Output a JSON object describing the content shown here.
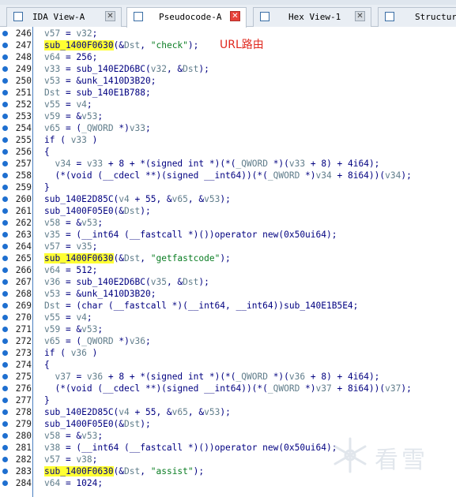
{
  "tabs": [
    {
      "label": "IDA View-A",
      "active": false,
      "icon": "ida-view-icon"
    },
    {
      "label": "Pseudocode-A",
      "active": true,
      "icon": "pseudocode-icon"
    },
    {
      "label": "Hex View-1",
      "active": false,
      "icon": "hex-view-icon"
    },
    {
      "label": "Structure",
      "active": false,
      "icon": "structure-icon"
    }
  ],
  "annotation": "URL路由",
  "watermark": "看雪",
  "colors": {
    "highlight": "#ffff33",
    "string": "#0a7d23",
    "variable": "#607d8b",
    "code": "#000080",
    "annotation": "#e0281e"
  },
  "lines": [
    {
      "n": "246",
      "code": "v57 = v32;"
    },
    {
      "n": "247",
      "code": "sub_1400F0630(&Dst, \"check\");",
      "hl": "sub_1400F0630"
    },
    {
      "n": "248",
      "code": "v64 = 256;"
    },
    {
      "n": "249",
      "code": "v33 = sub_140E2D6BC(v32, &Dst);"
    },
    {
      "n": "250",
      "code": "v53 = &unk_1410D3B20;"
    },
    {
      "n": "251",
      "code": "Dst = sub_140E1B788;"
    },
    {
      "n": "252",
      "code": "v55 = v4;"
    },
    {
      "n": "253",
      "code": "v59 = &v53;"
    },
    {
      "n": "254",
      "code": "v65 = (_QWORD *)v33;"
    },
    {
      "n": "255",
      "code": "if ( v33 )"
    },
    {
      "n": "256",
      "code": "{"
    },
    {
      "n": "257",
      "code": "  v34 = v33 + 8 + *(signed int *)(*(_QWORD *)(v33 + 8) + 4i64);"
    },
    {
      "n": "258",
      "code": "  (*(void (__cdecl **)(signed __int64))(*(_QWORD *)v34 + 8i64))(v34);"
    },
    {
      "n": "259",
      "code": "}"
    },
    {
      "n": "260",
      "code": "sub_140E2D85C(v4 + 55, &v65, &v53);"
    },
    {
      "n": "261",
      "code": "sub_1400F05E0(&Dst);"
    },
    {
      "n": "262",
      "code": "v58 = &v53;"
    },
    {
      "n": "263",
      "code": "v35 = (__int64 (__fastcall *)())operator new(0x50ui64);"
    },
    {
      "n": "264",
      "code": "v57 = v35;"
    },
    {
      "n": "265",
      "code": "sub_1400F0630(&Dst, \"getfastcode\");",
      "hl": "sub_1400F0630"
    },
    {
      "n": "266",
      "code": "v64 = 512;"
    },
    {
      "n": "267",
      "code": "v36 = sub_140E2D6BC(v35, &Dst);"
    },
    {
      "n": "268",
      "code": "v53 = &unk_1410D3B20;"
    },
    {
      "n": "269",
      "code": "Dst = (char (__fastcall *)(__int64, __int64))sub_140E1B5E4;"
    },
    {
      "n": "270",
      "code": "v55 = v4;"
    },
    {
      "n": "271",
      "code": "v59 = &v53;"
    },
    {
      "n": "272",
      "code": "v65 = (_QWORD *)v36;"
    },
    {
      "n": "273",
      "code": "if ( v36 )"
    },
    {
      "n": "274",
      "code": "{"
    },
    {
      "n": "275",
      "code": "  v37 = v36 + 8 + *(signed int *)(*(_QWORD *)(v36 + 8) + 4i64);"
    },
    {
      "n": "276",
      "code": "  (*(void (__cdecl **)(signed __int64))(*(_QWORD *)v37 + 8i64))(v37);"
    },
    {
      "n": "277",
      "code": "}"
    },
    {
      "n": "278",
      "code": "sub_140E2D85C(v4 + 55, &v65, &v53);"
    },
    {
      "n": "279",
      "code": "sub_1400F05E0(&Dst);"
    },
    {
      "n": "280",
      "code": "v58 = &v53;"
    },
    {
      "n": "281",
      "code": "v38 = (__int64 (__fastcall *)())operator new(0x50ui64);"
    },
    {
      "n": "282",
      "code": "v57 = v38;"
    },
    {
      "n": "283",
      "code": "sub_1400F0630(&Dst, \"assist\");",
      "hl": "sub_1400F0630"
    },
    {
      "n": "284",
      "code": "v64 = 1024;"
    }
  ]
}
